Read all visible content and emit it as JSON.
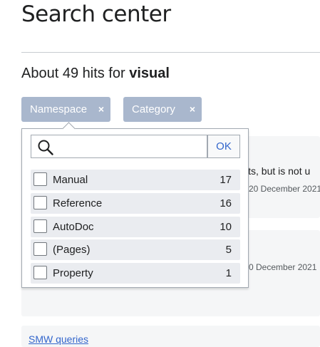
{
  "page": {
    "title": "Search center"
  },
  "summary": {
    "prefix": "About 49 hits for ",
    "query": "visual"
  },
  "filters": [
    {
      "label": "Namespace",
      "close": "×"
    },
    {
      "label": "Category",
      "close": "×"
    }
  ],
  "dropdown": {
    "search_placeholder": "",
    "ok_label": "OK",
    "items": [
      {
        "label": "Manual",
        "count": "17"
      },
      {
        "label": "Reference",
        "count": "16"
      },
      {
        "label": "AutoDoc",
        "count": "10"
      },
      {
        "label": "(Pages)",
        "count": "5"
      },
      {
        "label": "Property",
        "count": "1"
      }
    ]
  },
  "results": {
    "card1_snippet": "ists, but is not u",
    "card1_date": "20 December 2021",
    "card2_date": "0 December 2021",
    "card3_link": "SMW queries"
  }
}
